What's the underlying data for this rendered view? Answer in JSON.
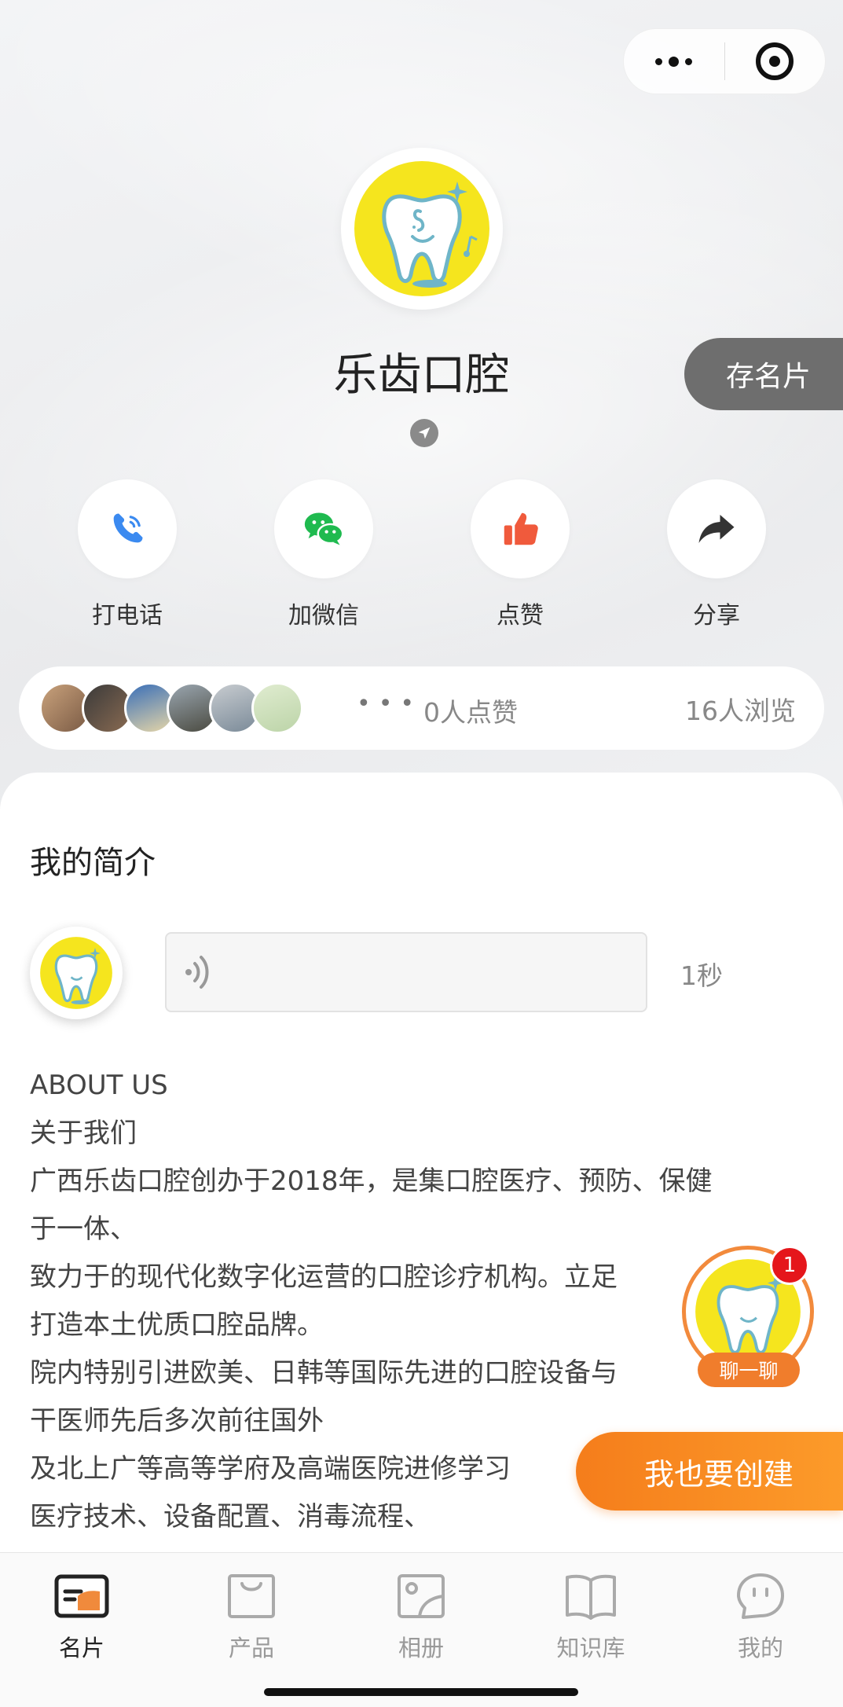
{
  "company": {
    "name": "乐齿口腔"
  },
  "save_card_label": "存名片",
  "actions": [
    {
      "label": "打电话",
      "icon": "phone-icon",
      "color": "#3b8af0"
    },
    {
      "label": "加微信",
      "icon": "wechat-icon",
      "color": "#1fba4f"
    },
    {
      "label": "点赞",
      "icon": "thumbs-up-icon",
      "color": "#f05a3c"
    },
    {
      "label": "分享",
      "icon": "share-icon",
      "color": "#333333"
    }
  ],
  "stats": {
    "likes": "0人点赞",
    "views": "16人浏览"
  },
  "intro": {
    "title": "我的简介",
    "voice_duration": "1秒",
    "lines": [
      "ABOUT US",
      "关于我们",
      "广西乐齿口腔创办于2018年，是集口腔医疗、预防、保健",
      "于一体、",
      "致力于的现代化数字化运营的口腔诊疗机构。立足",
      "打造本土优质口腔品牌。",
      "院内特别引进欧美、日韩等国际先进的口腔设备与",
      "干医师先后多次前往国外",
      "及北上广等高等学府及高端医院进修学习",
      "医疗技术、设备配置、消毒流程、"
    ]
  },
  "chat": {
    "badge": "1",
    "label": "聊一聊"
  },
  "create_button": "我也要创建",
  "tabs": [
    {
      "label": "名片",
      "icon": "card-icon",
      "active": true
    },
    {
      "label": "产品",
      "icon": "bag-icon",
      "active": false
    },
    {
      "label": "相册",
      "icon": "photo-icon",
      "active": false
    },
    {
      "label": "知识库",
      "icon": "book-icon",
      "active": false
    },
    {
      "label": "我的",
      "icon": "face-icon",
      "active": false
    }
  ],
  "colors": {
    "accent": "#f57d1b",
    "badge": "#e5161b",
    "logo_yellow": "#f5e51e"
  }
}
